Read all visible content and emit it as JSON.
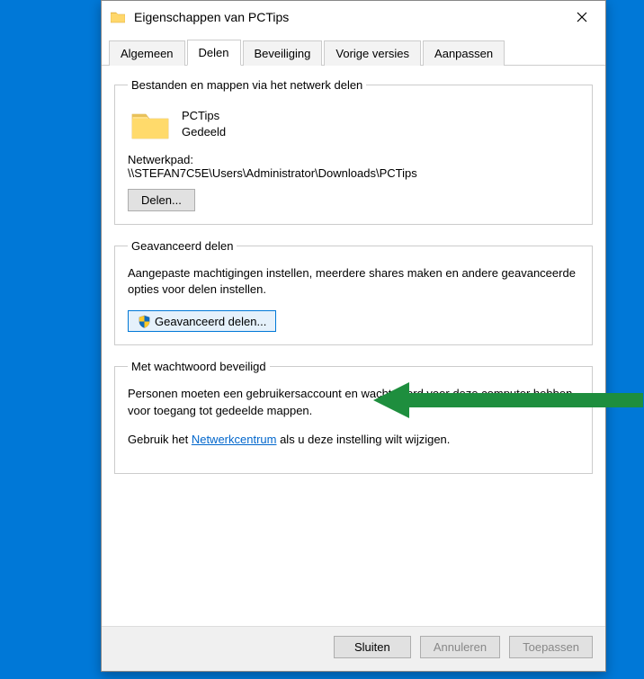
{
  "window": {
    "title": "Eigenschappen van PCTips"
  },
  "tabs": {
    "general": "Algemeen",
    "sharing": "Delen",
    "security": "Beveiliging",
    "previous": "Vorige versies",
    "customize": "Aanpassen"
  },
  "section1": {
    "legend": "Bestanden en mappen via het netwerk delen",
    "folder_name": "PCTips",
    "status": "Gedeeld",
    "netpath_label": "Netwerkpad:",
    "netpath": "\\\\STEFAN7C5E\\Users\\Administrator\\Downloads\\PCTips",
    "share_btn": "Delen..."
  },
  "section2": {
    "legend": "Geavanceerd delen",
    "desc": "Aangepaste machtigingen instellen, meerdere shares maken en andere geavanceerde opties voor delen instellen.",
    "adv_btn": "Geavanceerd delen..."
  },
  "section3": {
    "legend": "Met wachtwoord beveiligd",
    "line1": "Personen moeten een gebruikersaccount en wachtwoord voor deze computer hebben voor toegang tot gedeelde mappen.",
    "line2_pre": "Gebruik het ",
    "link": "Netwerkcentrum",
    "line2_post": " als u deze instelling wilt wijzigen."
  },
  "footer": {
    "close": "Sluiten",
    "cancel": "Annuleren",
    "apply": "Toepassen"
  }
}
